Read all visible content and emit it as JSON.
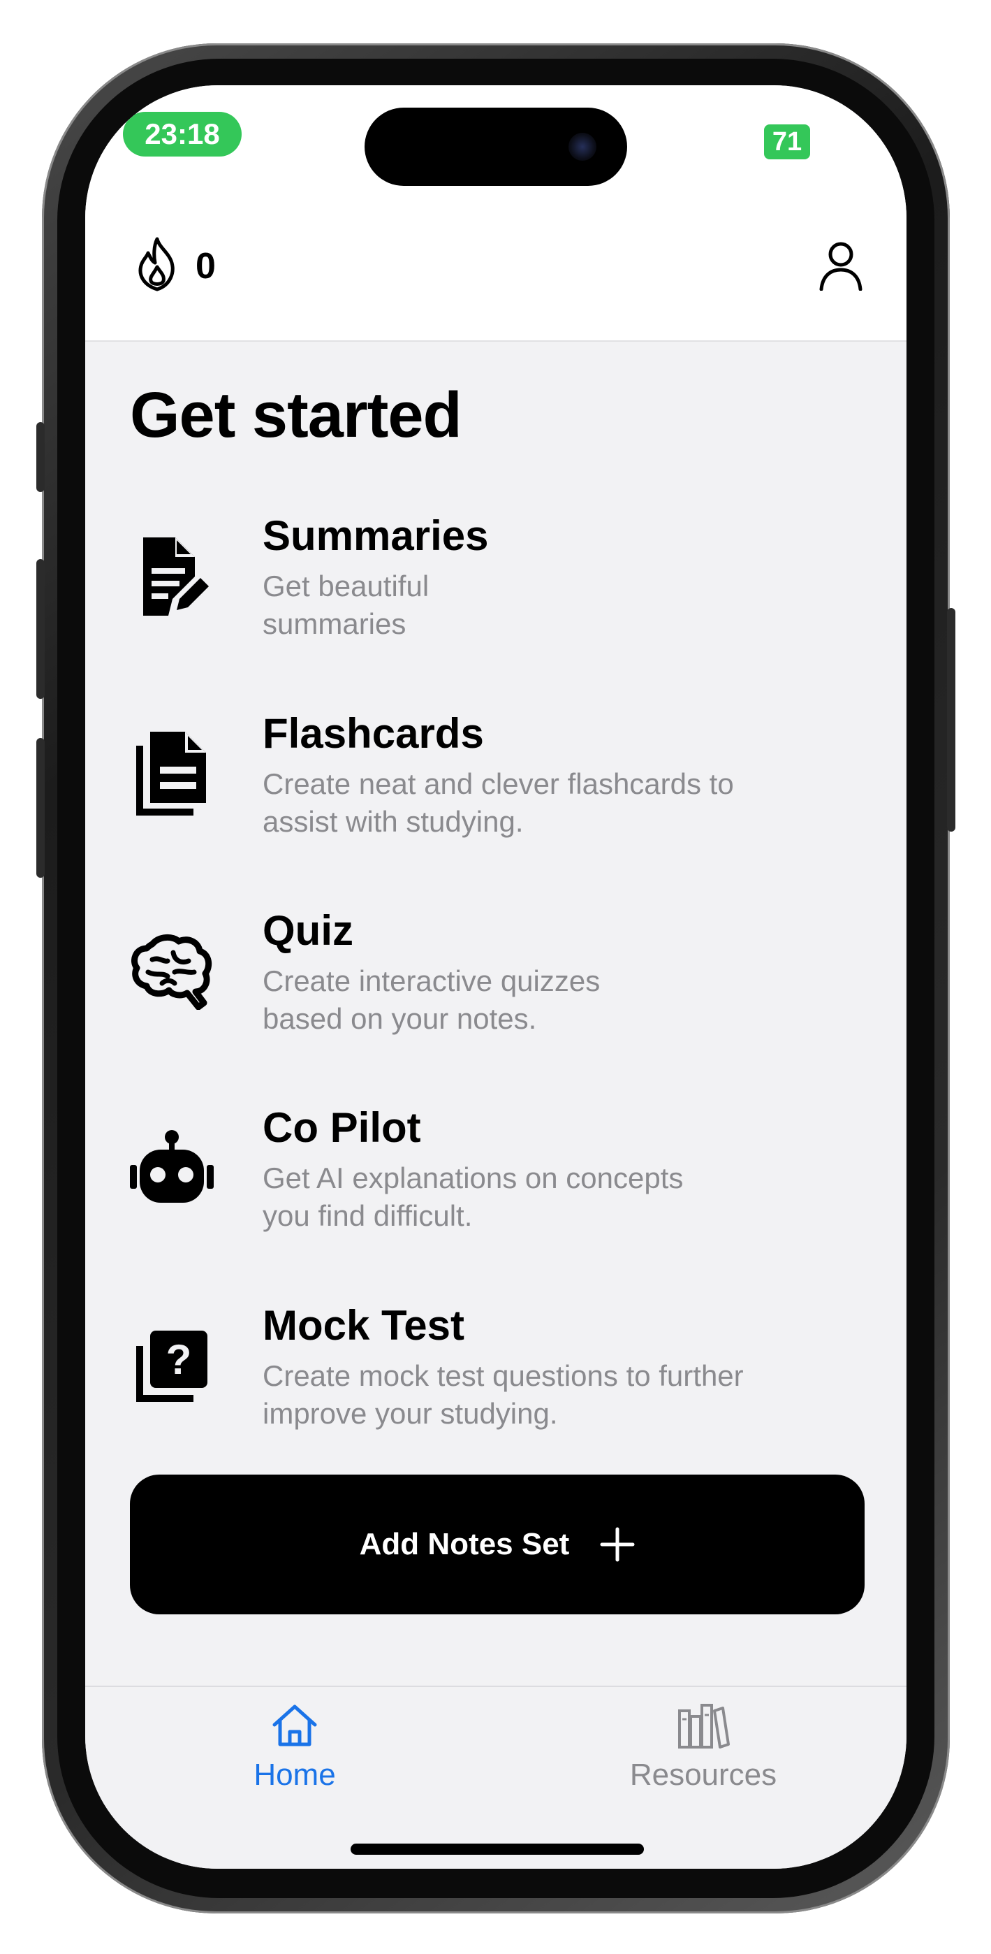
{
  "status_bar": {
    "time": "23:18",
    "battery": "71"
  },
  "header": {
    "streak_count": "0"
  },
  "main": {
    "title": "Get started",
    "features": [
      {
        "icon": "summary-icon",
        "title": "Summaries",
        "description_line1": "Get beautiful",
        "description_line2": "summaries"
      },
      {
        "icon": "flashcards-icon",
        "title": "Flashcards",
        "description_line1": "Create neat and clever flashcards to",
        "description_line2": "assist with studying."
      },
      {
        "icon": "brain-icon",
        "title": "Quiz",
        "description_line1": "Create interactive quizzes",
        "description_line2": "based on your notes."
      },
      {
        "icon": "robot-icon",
        "title": "Co Pilot",
        "description_line1": "Get AI explanations on concepts",
        "description_line2": "you find difficult."
      },
      {
        "icon": "question-icon",
        "title": "Mock Test",
        "description_line1": "Create mock test questions to further",
        "description_line2": "improve your studying."
      }
    ],
    "add_button_label": "Add Notes Set"
  },
  "tabbar": {
    "tabs": [
      {
        "label": "Home",
        "icon": "house-icon",
        "active": true
      },
      {
        "label": "Resources",
        "icon": "books-icon",
        "active": false
      }
    ]
  },
  "colors": {
    "accent": "#1a73e8",
    "status_green": "#34c759",
    "background": "#f2f2f4",
    "secondary_text": "#8a8a8e"
  }
}
